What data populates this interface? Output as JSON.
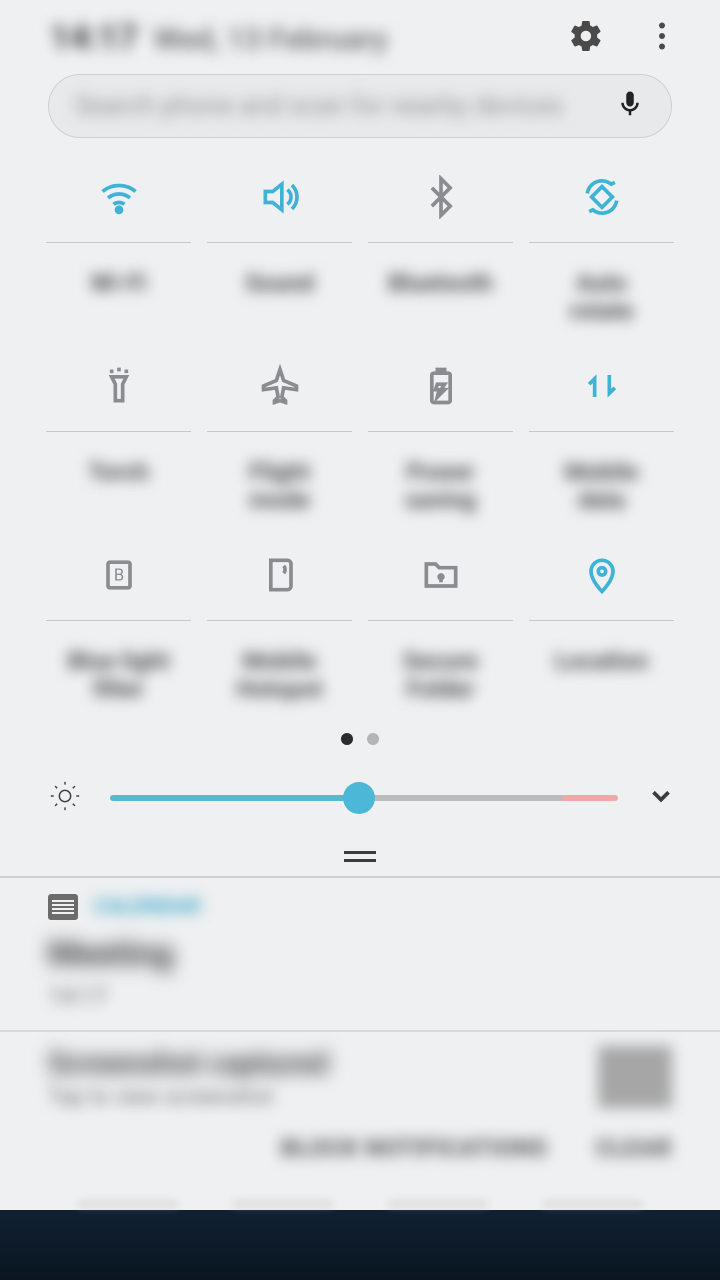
{
  "header": {
    "time": "14:17",
    "date": "Wed, 13 February"
  },
  "search": {
    "placeholder": "Search phone and scan for nearby devices"
  },
  "tiles": [
    {
      "label": "Wi-Fi",
      "icon": "wifi",
      "active": true
    },
    {
      "label": "Sound",
      "icon": "sound",
      "active": true
    },
    {
      "label": "Bluetooth",
      "icon": "bluetooth",
      "active": false
    },
    {
      "label": "Auto\nrotate",
      "icon": "rotate",
      "active": true
    },
    {
      "label": "Torch",
      "icon": "torch",
      "active": false
    },
    {
      "label": "Flight\nmode",
      "icon": "plane",
      "active": false
    },
    {
      "label": "Power\nsaving",
      "icon": "battery",
      "active": false
    },
    {
      "label": "Mobile\ndata",
      "icon": "data",
      "active": true
    },
    {
      "label": "Blue light\nfilter",
      "icon": "bluelight",
      "active": false
    },
    {
      "label": "Mobile\nHotspot",
      "icon": "hotspot",
      "active": false
    },
    {
      "label": "Secure\nFolder",
      "icon": "secure",
      "active": false
    },
    {
      "label": "Location",
      "icon": "location",
      "active": true
    }
  ],
  "pager": {
    "current": 0,
    "total": 2
  },
  "brightness": {
    "value": 49
  },
  "notifications": [
    {
      "app": "CALENDAR",
      "title": "Meeting",
      "time": "14:17"
    },
    {
      "title": "Screenshot captured",
      "subtitle": "Tap to view screenshot",
      "actions": {
        "block": "BLOCK NOTIFICATIONS",
        "clear": "CLEAR"
      }
    }
  ]
}
